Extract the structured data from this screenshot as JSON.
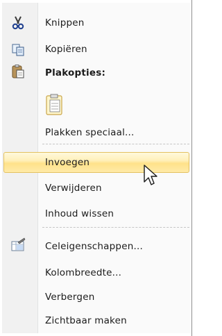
{
  "menu": {
    "items": [
      {
        "label": "Knippen",
        "icon": "scissors-icon"
      },
      {
        "label": "Kopiëren",
        "icon": "copy-icon"
      },
      {
        "label": "Plakopties:",
        "icon": "clipboard-paste-icon"
      },
      {
        "label": "Plakken speciaal..."
      },
      {
        "label": "Invoegen",
        "highlighted": true
      },
      {
        "label": "Verwijderen"
      },
      {
        "label": "Inhoud wissen"
      },
      {
        "label": "Celeigenschappen...",
        "icon": "format-cells-icon"
      },
      {
        "label": "Kolombreedte..."
      },
      {
        "label": "Verbergen"
      },
      {
        "label": "Zichtbaar maken"
      }
    ],
    "paste_options": [
      {
        "icon": "paste-option-icon"
      }
    ],
    "highlight_color": "#ffe28a"
  }
}
